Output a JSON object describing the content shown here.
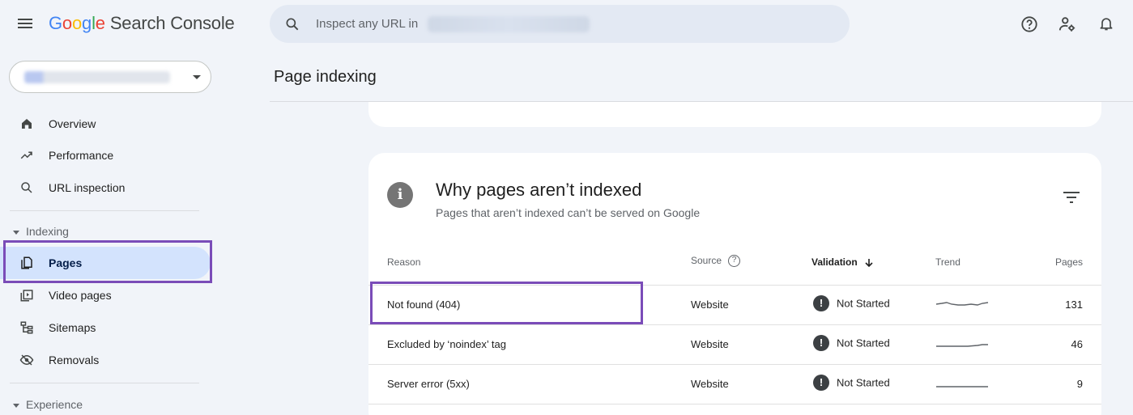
{
  "app": {
    "logo_parts": [
      "G",
      "o",
      "o",
      "g",
      "l",
      "e"
    ],
    "product_name": "Search Console"
  },
  "search": {
    "placeholder": "Inspect any URL in"
  },
  "sidebar": {
    "items_top": [
      {
        "label": "Overview",
        "icon": "home-icon"
      },
      {
        "label": "Performance",
        "icon": "trending-icon"
      },
      {
        "label": "URL inspection",
        "icon": "search-icon"
      }
    ],
    "indexing_section": "Indexing",
    "indexing_items": [
      {
        "label": "Pages",
        "icon": "pages-icon",
        "active": true
      },
      {
        "label": "Video pages",
        "icon": "video-pages-icon"
      },
      {
        "label": "Sitemaps",
        "icon": "sitemap-icon"
      },
      {
        "label": "Removals",
        "icon": "removals-icon"
      }
    ],
    "experience_section": "Experience"
  },
  "main": {
    "page_title": "Page indexing",
    "card": {
      "title": "Why pages aren’t indexed",
      "subtitle": "Pages that aren’t indexed can’t be served on Google",
      "columns": {
        "reason": "Reason",
        "source": "Source",
        "validation": "Validation",
        "trend": "Trend",
        "pages": "Pages"
      },
      "rows": [
        {
          "reason": "Not found (404)",
          "source": "Website",
          "validation": "Not Started",
          "pages": "131"
        },
        {
          "reason": "Excluded by ‘noindex’ tag",
          "source": "Website",
          "validation": "Not Started",
          "pages": "46"
        },
        {
          "reason": "Server error (5xx)",
          "source": "Website",
          "validation": "Not Started",
          "pages": "9"
        }
      ]
    }
  },
  "colors": {
    "accent_highlight": "#7a4cb8",
    "nav_active_bg": "#d3e3fd",
    "background": "#f1f4f9"
  }
}
